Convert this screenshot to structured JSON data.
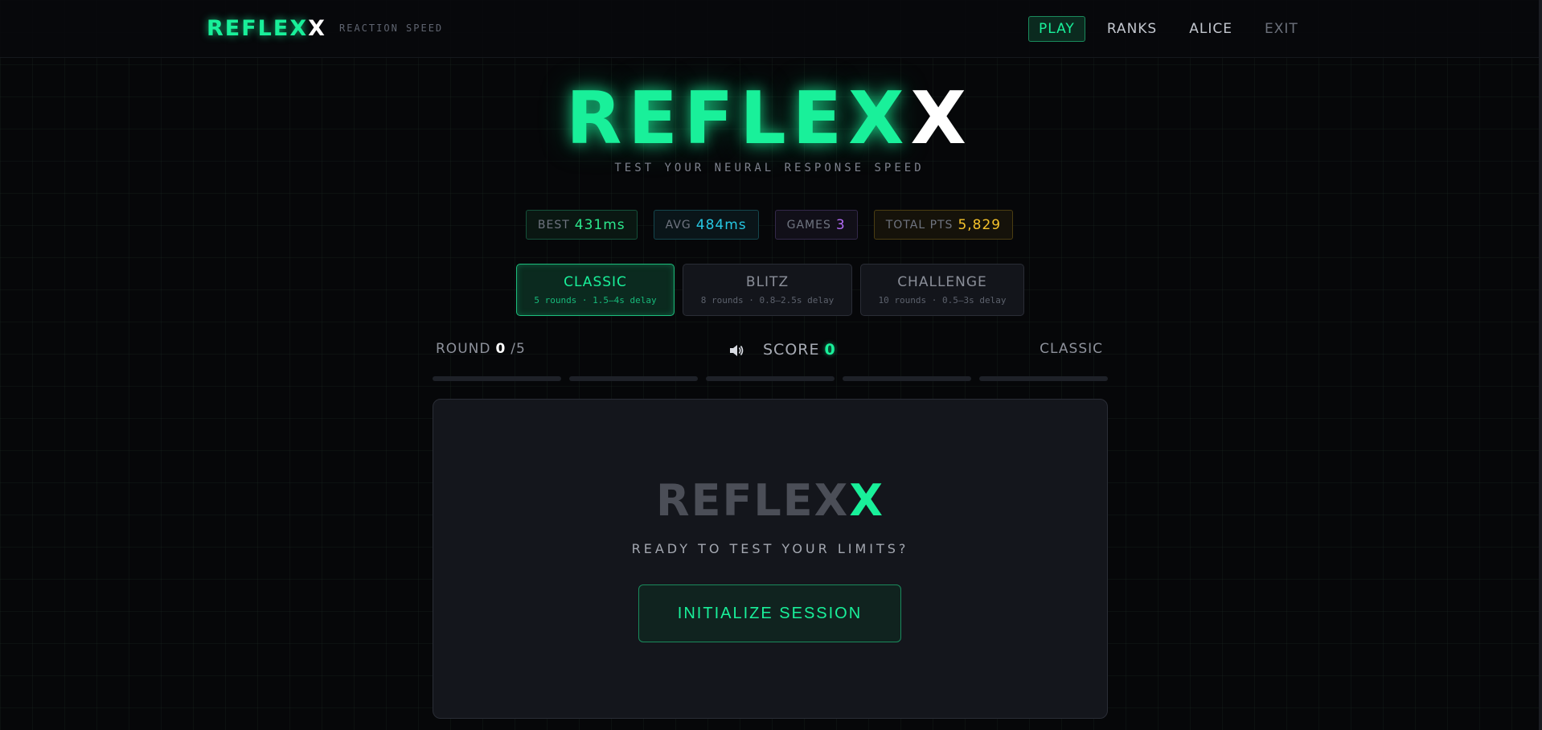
{
  "header": {
    "logo_main": "REFLEX",
    "logo_x": "X",
    "tagline": "REACTION SPEED",
    "nav": [
      {
        "label": "PLAY"
      },
      {
        "label": "RANKS"
      },
      {
        "label": "ALICE"
      },
      {
        "label": "EXIT"
      }
    ]
  },
  "hero": {
    "title_main": "REFLEX",
    "title_x": "X",
    "subtitle": "TEST YOUR NEURAL RESPONSE SPEED"
  },
  "stats": {
    "best": {
      "label": "BEST",
      "value": "431ms"
    },
    "avg": {
      "label": "AVG",
      "value": "484ms"
    },
    "games": {
      "label": "GAMES",
      "value": "3"
    },
    "total": {
      "label": "TOTAL PTS",
      "value": "5,829"
    }
  },
  "modes": [
    {
      "name": "CLASSIC",
      "desc": "5 rounds · 1.5–4s delay"
    },
    {
      "name": "BLITZ",
      "desc": "8 rounds · 0.8–2.5s delay"
    },
    {
      "name": "CHALLENGE",
      "desc": "10 rounds · 0.5–3s delay"
    }
  ],
  "status": {
    "round_label": "ROUND",
    "round_current": "0",
    "round_total": "/5",
    "score_label": "SCORE",
    "score_value": "0",
    "mode_label": "CLASSIC",
    "sound_icon": "speaker-icon"
  },
  "panel": {
    "logo_main": "REFLEX",
    "logo_x": "X",
    "prompt": "READY TO TEST YOUR LIMITS?",
    "button_label": "INITIALIZE SESSION"
  },
  "colors": {
    "accent": "#19f09a",
    "avg": "#26c7e3",
    "games": "#b26bf5",
    "points": "#f5c22b"
  }
}
